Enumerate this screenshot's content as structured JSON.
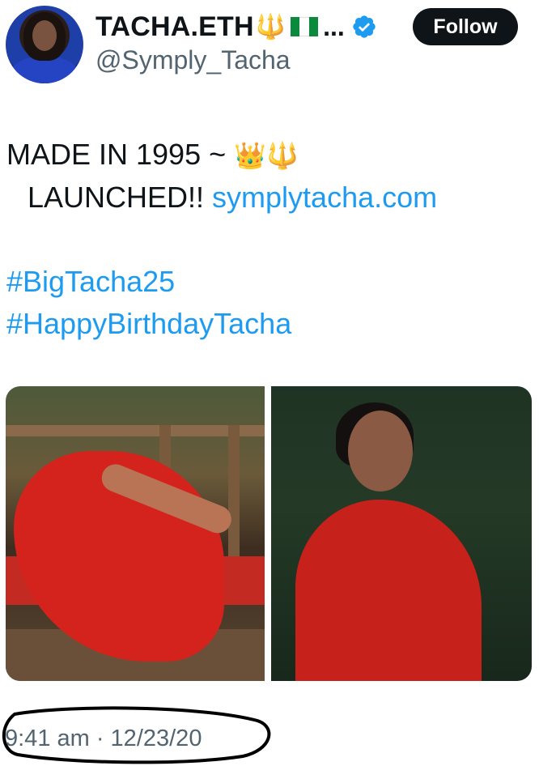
{
  "author": {
    "display_name": "TACHA.ETH",
    "name_emoji_trident": "🔱",
    "name_ellipsis": "...",
    "handle": "@Symply_Tacha",
    "avatar_icon": "avatar-photo",
    "verified_icon": "verified-badge-icon"
  },
  "follow_label": "Follow",
  "tweet": {
    "line1_text": "MADE IN 1995 ~ ",
    "line1_emoji_crown": "👑",
    "line1_emoji_trident": "🔱",
    "line2_text": "LAUNCHED!! ",
    "line2_link": "symplytacha.com",
    "hashtags": [
      "#BigTacha25",
      "#HappyBirthdayTacha"
    ]
  },
  "media": {
    "count": 2,
    "items": [
      "photo-woman-reclining-red-dress",
      "photo-woman-portrait-red-dress"
    ]
  },
  "timestamp": "9:41 am · 12/23/20",
  "colors": {
    "accent": "#1d9bf0",
    "text": "#0f1419",
    "secondary": "#536471",
    "follow_bg": "#0f1419"
  }
}
